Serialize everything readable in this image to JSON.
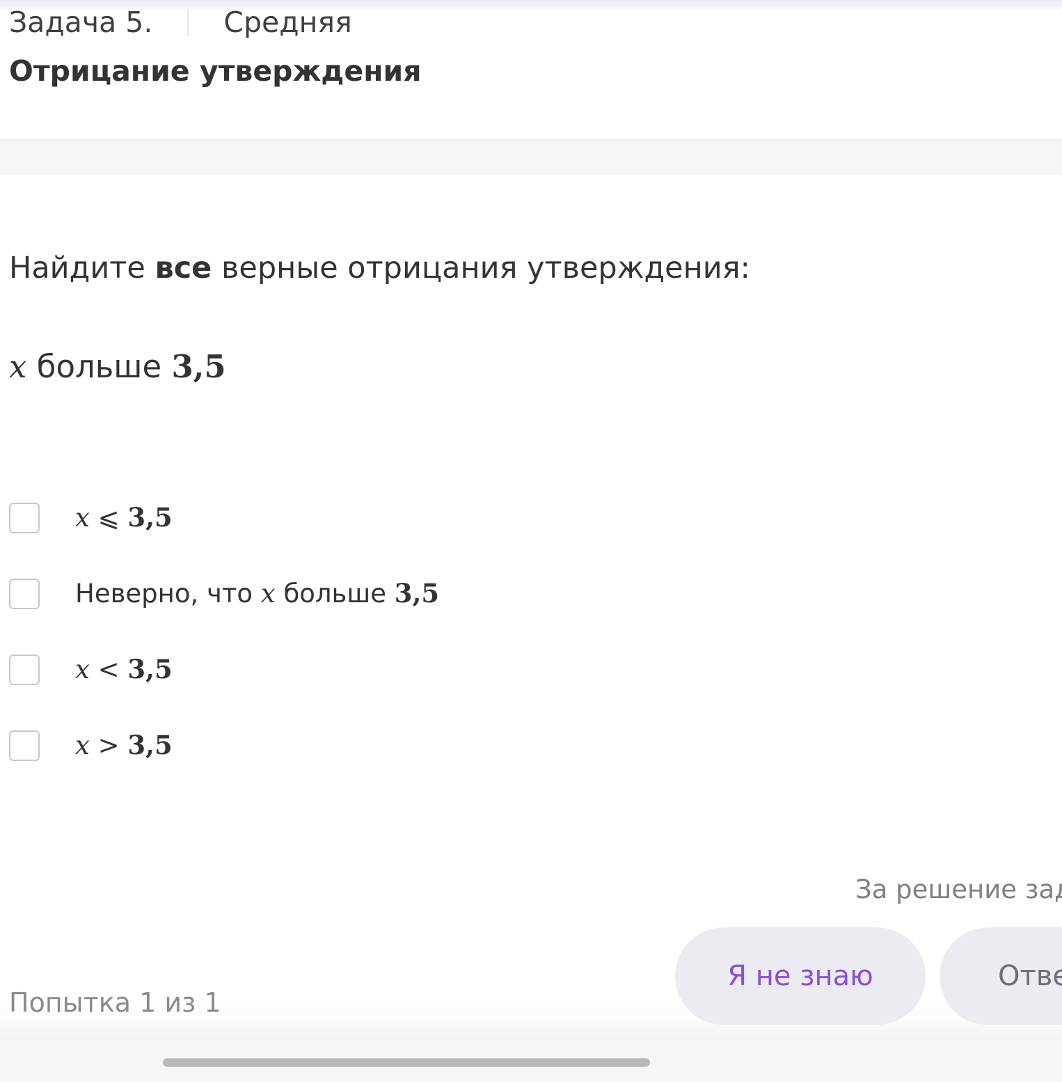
{
  "header": {
    "task_number": "Задача 5.",
    "difficulty": "Средняя",
    "title": "Отрицание утверждения"
  },
  "question": {
    "prefix": "Найдите",
    "emphasis": "все",
    "suffix": "верные отрицания утверждения:"
  },
  "statement": {
    "variable": "x",
    "word": "больше",
    "number": "3,5"
  },
  "options": [
    {
      "variable": "x",
      "relation": "⩽",
      "number": "3,5",
      "checked": false
    },
    {
      "prefix": "Неверно, что",
      "variable": "x",
      "word": "больше",
      "number": "3,5",
      "checked": false
    },
    {
      "variable": "x",
      "relation": "<",
      "number": "3,5",
      "checked": false
    },
    {
      "variable": "x",
      "relation": ">",
      "number": "3,5",
      "checked": false
    }
  ],
  "footer": {
    "reward_text": "За решение зада",
    "attempt": "Попытка 1 из 1",
    "dont_know_label": "Я не знаю",
    "answer_label": "Отве"
  },
  "colors": {
    "accent_purple": "#8a4fd8",
    "button_bg": "#ebebf1",
    "band_bg": "#f4f5f9"
  }
}
